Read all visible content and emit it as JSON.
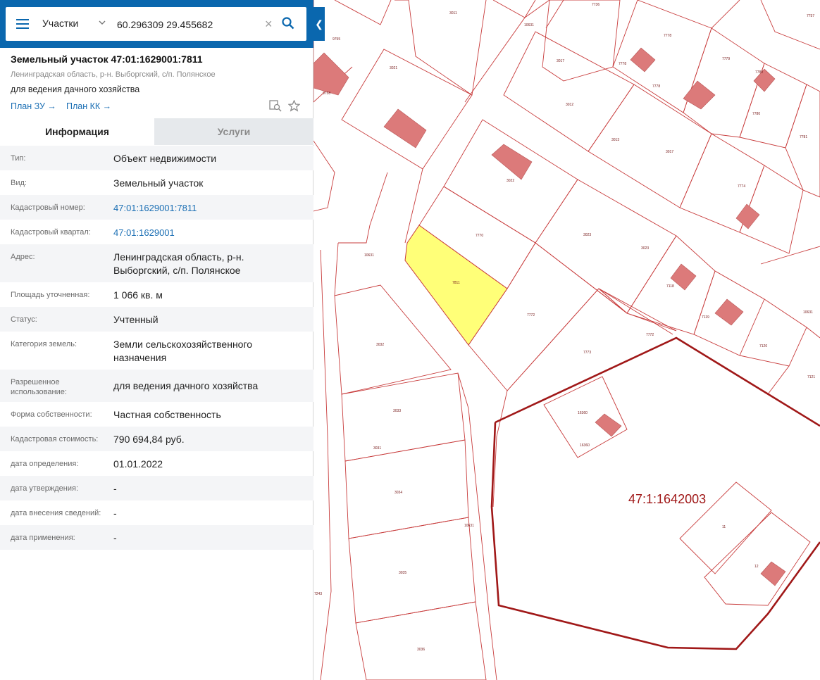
{
  "search": {
    "type_label": "Участки",
    "query": "60.296309 29.455682"
  },
  "header": {
    "title": "Земельный участок 47:01:1629001:7811",
    "subtitle": "Ленинградская область, р-н. Выборгский, с/п. Полянское",
    "purpose": "для ведения дачного хозяйства",
    "links": [
      "План ЗУ →",
      "План КК →"
    ]
  },
  "tabs": [
    "Информация",
    "Услуги"
  ],
  "info_rows": [
    {
      "label": "Тип:",
      "value": "Объект недвижимости"
    },
    {
      "label": "Вид:",
      "value": "Земельный участок"
    },
    {
      "label": "Кадастровый номер:",
      "value": "47:01:1629001:7811"
    },
    {
      "label": "Кадастровый квартал:",
      "value": "47:01:1629001"
    },
    {
      "label": "Адрес:",
      "value": "Ленинградская область, р-н. Выборгский, с/п. Полянское"
    },
    {
      "label": "Площадь уточненная:",
      "value": "1 066 кв. м"
    },
    {
      "label": "Статус:",
      "value": "Учтенный"
    },
    {
      "label": "Категория земель:",
      "value": "Земли сельскохозяйственного назначения"
    },
    {
      "label": "Разрешенное использование:",
      "value": "для ведения дачного хозяйства"
    },
    {
      "label": "Форма собственности:",
      "value": "Частная собственность"
    },
    {
      "label": "Кадастровая стоимость:",
      "value": "790 694,84 руб."
    },
    {
      "label": "дата определения:",
      "value": "01.01.2022"
    },
    {
      "label": "дата утверждения:",
      "value": "-"
    },
    {
      "label": "дата внесения сведений:",
      "value": "-"
    },
    {
      "label": "дата применения:",
      "value": "-"
    }
  ],
  "map": {
    "quarter_label": "47:1:1642003",
    "parcel_labels": [
      "7811",
      "7770",
      "7772",
      "7773",
      "3032",
      "3021",
      "3011",
      "3017",
      "3012",
      "3013",
      "3023",
      "10631",
      "3031",
      "3033",
      "3034",
      "3035",
      "3036",
      "16360",
      "11",
      "12",
      "7774",
      "7778",
      "7779",
      "7780",
      "7781",
      "7118",
      "7119",
      "7120",
      "7121",
      "7243"
    ],
    "colors": {
      "parcel_line": "#c83c3c",
      "selected_fill": "#ffff78",
      "building_fill": "#dc7a7a",
      "quarter_border": "#a01818"
    }
  }
}
